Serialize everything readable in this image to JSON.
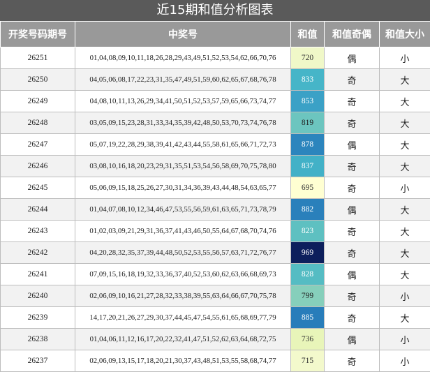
{
  "title": "近15期和值分析图表",
  "columns": [
    "开奖号码期号",
    "中奖号",
    "和值",
    "和值奇偶",
    "和值大小"
  ],
  "rows": [
    {
      "issue": "26251",
      "numbers": "01,04,08,09,10,11,18,26,28,29,43,49,51,52,53,54,62,66,70,76",
      "sum": "720",
      "parity": "偶",
      "size": "小",
      "sum_bg": "#f0f8c8",
      "sum_fg": "#333333"
    },
    {
      "issue": "26250",
      "numbers": "04,05,06,08,17,22,23,31,35,47,49,51,59,60,62,65,67,68,76,78",
      "sum": "833",
      "parity": "奇",
      "size": "大",
      "sum_bg": "#46b5c8",
      "sum_fg": "#ffffff"
    },
    {
      "issue": "26249",
      "numbers": "04,08,10,11,13,26,29,34,41,50,51,52,53,57,59,65,66,73,74,77",
      "sum": "853",
      "parity": "奇",
      "size": "大",
      "sum_bg": "#3ba1c6",
      "sum_fg": "#ffffff"
    },
    {
      "issue": "26248",
      "numbers": "03,05,09,15,23,28,31,33,34,35,39,42,48,50,53,70,73,74,76,78",
      "sum": "819",
      "parity": "奇",
      "size": "大",
      "sum_bg": "#6cc5bf",
      "sum_fg": "#222222"
    },
    {
      "issue": "26247",
      "numbers": "05,07,19,22,28,29,38,39,41,42,43,44,55,58,61,65,66,71,72,73",
      "sum": "878",
      "parity": "偶",
      "size": "大",
      "sum_bg": "#2c85bd",
      "sum_fg": "#ffffff"
    },
    {
      "issue": "26246",
      "numbers": "03,08,10,16,18,20,23,29,31,35,51,53,54,56,58,69,70,75,78,80",
      "sum": "837",
      "parity": "奇",
      "size": "大",
      "sum_bg": "#42b1c7",
      "sum_fg": "#ffffff"
    },
    {
      "issue": "26245",
      "numbers": "05,06,09,15,18,25,26,27,30,31,34,36,39,43,44,48,54,63,65,77",
      "sum": "695",
      "parity": "奇",
      "size": "小",
      "sum_bg": "#ffffd2",
      "sum_fg": "#333333"
    },
    {
      "issue": "26244",
      "numbers": "01,04,07,08,10,12,34,46,47,53,55,56,59,61,63,65,71,73,78,79",
      "sum": "882",
      "parity": "偶",
      "size": "大",
      "sum_bg": "#2a80bb",
      "sum_fg": "#ffffff"
    },
    {
      "issue": "26243",
      "numbers": "01,02,03,09,21,29,31,36,37,41,43,46,50,55,64,67,68,70,74,76",
      "sum": "823",
      "parity": "奇",
      "size": "大",
      "sum_bg": "#5ec0c1",
      "sum_fg": "#ffffff"
    },
    {
      "issue": "26242",
      "numbers": "04,20,28,32,35,37,39,44,48,50,52,53,55,56,57,63,71,72,76,77",
      "sum": "969",
      "parity": "奇",
      "size": "大",
      "sum_bg": "#0d1f5c",
      "sum_fg": "#ffffff"
    },
    {
      "issue": "26241",
      "numbers": "07,09,15,16,18,19,32,33,36,37,40,52,53,60,62,63,66,68,69,73",
      "sum": "828",
      "parity": "偶",
      "size": "大",
      "sum_bg": "#55bcc3",
      "sum_fg": "#ffffff"
    },
    {
      "issue": "26240",
      "numbers": "02,06,09,10,16,21,27,28,32,33,38,39,55,63,64,66,67,70,75,78",
      "sum": "799",
      "parity": "奇",
      "size": "小",
      "sum_bg": "#86cfbb",
      "sum_fg": "#222222"
    },
    {
      "issue": "26239",
      "numbers": "14,17,20,21,26,27,29,30,37,44,45,47,54,55,61,65,68,69,77,79",
      "sum": "885",
      "parity": "奇",
      "size": "大",
      "sum_bg": "#287dba",
      "sum_fg": "#ffffff"
    },
    {
      "issue": "26238",
      "numbers": "01,04,06,11,12,16,17,20,22,32,41,47,51,52,62,63,64,68,72,75",
      "sum": "736",
      "parity": "偶",
      "size": "小",
      "sum_bg": "#e8f5b9",
      "sum_fg": "#333333"
    },
    {
      "issue": "26237",
      "numbers": "02,06,09,13,15,17,18,20,21,30,37,43,48,51,53,55,58,68,74,77",
      "sum": "715",
      "parity": "奇",
      "size": "小",
      "sum_bg": "#f3f9cc",
      "sum_fg": "#333333"
    }
  ]
}
